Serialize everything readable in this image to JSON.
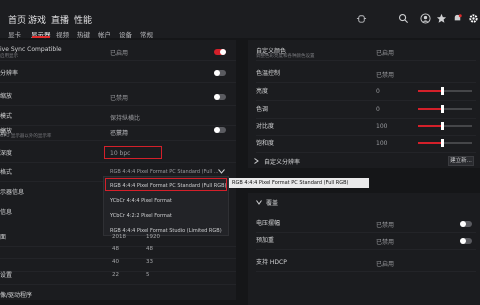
{
  "nav": {
    "main": [
      "首页",
      "游戏",
      "直播",
      "性能"
    ],
    "sub": [
      "显卡",
      "显示器",
      "视频",
      "热键",
      "帐户",
      "设备",
      "常规"
    ]
  },
  "icons": {
    "top": [
      "bug-icon",
      "search-icon",
      "account-icon",
      "star-icon",
      "notification-icon",
      "settings-icon"
    ]
  },
  "left": {
    "rows": [
      {
        "label": "ive Sync Compatible",
        "desc": "启用显示",
        "value": "已启用",
        "toggle": true
      },
      {
        "label": "分辨率",
        "desc": "",
        "value": "",
        "toggle": false
      },
      {
        "label": "缩放",
        "desc": "",
        "value": "已禁用",
        "toggle": false
      },
      {
        "label": "模式",
        "desc": "",
        "value": "保持纵横比",
        "toggle": null
      },
      {
        "label": "缩放",
        "desc": "GPU 显示器以外的显示率",
        "value": "已禁用",
        "toggle": false
      },
      {
        "label": "式",
        "desc": "",
        "value": "不支持",
        "toggle": false
      }
    ],
    "depth": {
      "label": "深度",
      "value": "10 bpc"
    },
    "format": {
      "label": "格式",
      "value": "RGB 4:4:4 Pixel Format PC Standard (Full ..."
    },
    "format_options": [
      "RGB 4:4:4 Pixel Format PC Standard (Full RGB)",
      "YCbCr 4:4:4 Pixel Format",
      "YCbCr 4:2:2 Pixel Format",
      "RGB 4:4:4 Pixel Format Studio (Limited RGB)"
    ],
    "tooltip": "RGB 4:4:4 Pixel Format PC Standard (Full RGB)",
    "table": {
      "rows": [
        {
          "label": "示器信息",
          "cells": []
        },
        {
          "label": "信息",
          "cells": []
        },
        {
          "label": "面",
          "cells": [
            "2018",
            "1920"
          ]
        },
        {
          "label": "",
          "cells": [
            "48",
            "48"
          ]
        },
        {
          "label": "",
          "cells": [
            "40",
            "33"
          ]
        },
        {
          "label": "设置",
          "cells": [
            "22",
            "5"
          ]
        }
      ]
    },
    "bottom_label": "像/驱动程序"
  },
  "right": {
    "rows": [
      {
        "label": "自定义颜色",
        "desc": "调整色彩亮度和各种颜色设置",
        "value": "已启用"
      },
      {
        "label": "色温控制",
        "desc": "",
        "value": "已禁用"
      }
    ],
    "sliders": [
      {
        "label": "亮度",
        "value": "0",
        "level": 0.44
      },
      {
        "label": "色调",
        "value": "0",
        "level": 0.44
      },
      {
        "label": "对比度",
        "value": "100",
        "level": 0.44
      },
      {
        "label": "饱和度",
        "value": "100",
        "level": 0.44
      }
    ],
    "custom_res": {
      "label": "自定义分辨率",
      "button": "建立新..."
    },
    "overrides_label": "覆盖",
    "voltage": {
      "label": "电压摆幅",
      "value": "已禁用"
    },
    "preemphasis": {
      "label": "预加重",
      "value": "已禁用"
    },
    "hdcp": {
      "label": "支持 HDCP",
      "value": "已启用"
    }
  }
}
